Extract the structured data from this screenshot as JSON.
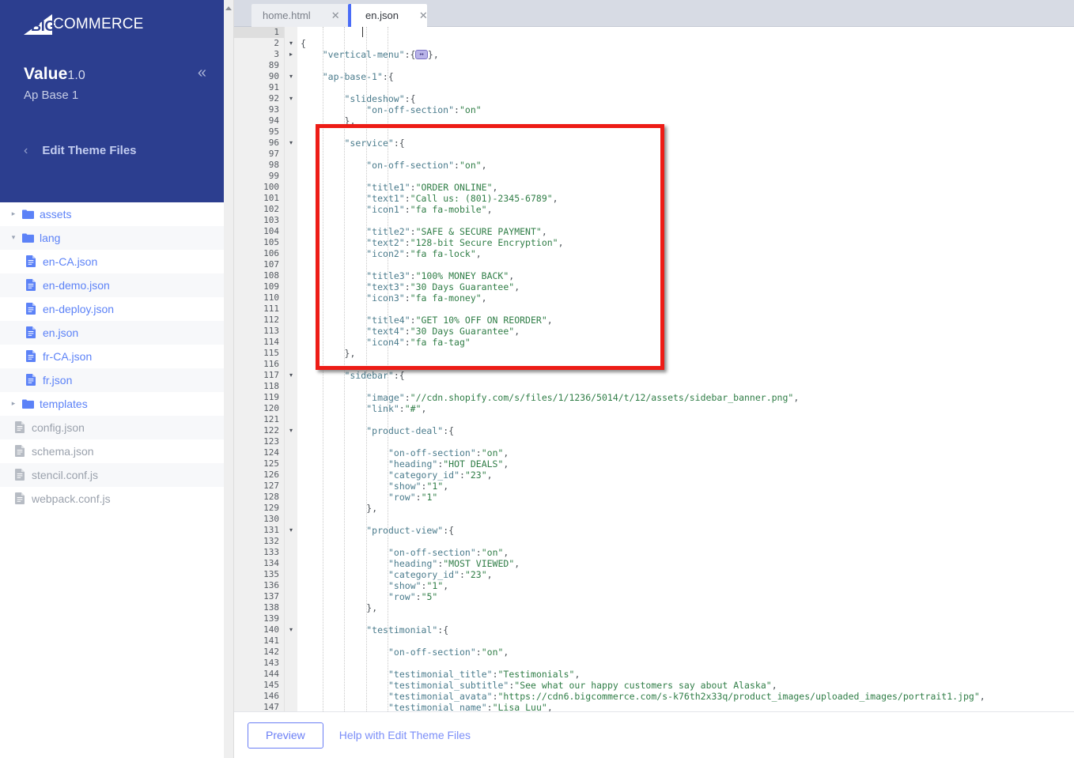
{
  "sidebar": {
    "brand": "COMMERCE",
    "brand_mark": "BIG",
    "theme_name": "Value",
    "theme_version": "1.0",
    "theme_variation": "Ap Base 1",
    "collapse_icon": "double-chevron-left-icon",
    "back_icon": "chevron-left-icon",
    "edit_theme_label": "Edit Theme Files",
    "tree": [
      {
        "label": "assets",
        "type": "folder",
        "state": "collapsed",
        "depth": 1,
        "muted": false
      },
      {
        "label": "lang",
        "type": "folder",
        "state": "expanded",
        "depth": 1,
        "muted": false
      },
      {
        "label": "en-CA.json",
        "type": "file",
        "state": "none",
        "depth": 2,
        "muted": false
      },
      {
        "label": "en-demo.json",
        "type": "file",
        "state": "none",
        "depth": 2,
        "muted": false
      },
      {
        "label": "en-deploy.json",
        "type": "file",
        "state": "none",
        "depth": 2,
        "muted": false
      },
      {
        "label": "en.json",
        "type": "file",
        "state": "none",
        "depth": 2,
        "muted": false
      },
      {
        "label": "fr-CA.json",
        "type": "file",
        "state": "none",
        "depth": 2,
        "muted": false
      },
      {
        "label": "fr.json",
        "type": "file",
        "state": "none",
        "depth": 2,
        "muted": false
      },
      {
        "label": "templates",
        "type": "folder",
        "state": "collapsed",
        "depth": 1,
        "muted": false
      },
      {
        "label": "config.json",
        "type": "file",
        "state": "none",
        "depth": 0,
        "muted": true
      },
      {
        "label": "schema.json",
        "type": "file",
        "state": "none",
        "depth": 0,
        "muted": true
      },
      {
        "label": "stencil.conf.js",
        "type": "file",
        "state": "none",
        "depth": 0,
        "muted": true
      },
      {
        "label": "webpack.conf.js",
        "type": "file",
        "state": "none",
        "depth": 0,
        "muted": true
      }
    ]
  },
  "tabs": [
    {
      "label": "home.html",
      "active": false,
      "close_icon": "close-icon"
    },
    {
      "label": "en.json",
      "active": true,
      "close_icon": "close-icon"
    }
  ],
  "editor": {
    "lines": [
      {
        "n": "1",
        "fold": "",
        "text": "",
        "current": true
      },
      {
        "n": "2",
        "fold": "▾",
        "text": "{"
      },
      {
        "n": "3",
        "fold": "▸",
        "text": "    \"vertical-menu\":{@FOLD@},"
      },
      {
        "n": "89",
        "fold": "",
        "text": ""
      },
      {
        "n": "90",
        "fold": "▾",
        "text": "    \"ap-base-1\":{"
      },
      {
        "n": "91",
        "fold": "",
        "text": ""
      },
      {
        "n": "92",
        "fold": "▾",
        "text": "        \"slideshow\":{"
      },
      {
        "n": "93",
        "fold": "",
        "text": "            \"on-off-section\":\"on\""
      },
      {
        "n": "94",
        "fold": "",
        "text": "        },"
      },
      {
        "n": "95",
        "fold": "",
        "text": ""
      },
      {
        "n": "96",
        "fold": "▾",
        "text": "        \"service\":{"
      },
      {
        "n": "97",
        "fold": "",
        "text": ""
      },
      {
        "n": "98",
        "fold": "",
        "text": "            \"on-off-section\":\"on\","
      },
      {
        "n": "99",
        "fold": "",
        "text": ""
      },
      {
        "n": "100",
        "fold": "",
        "text": "            \"title1\":\"ORDER ONLINE\","
      },
      {
        "n": "101",
        "fold": "",
        "text": "            \"text1\":\"Call us: (801)-2345-6789\","
      },
      {
        "n": "102",
        "fold": "",
        "text": "            \"icon1\":\"fa fa-mobile\","
      },
      {
        "n": "103",
        "fold": "",
        "text": ""
      },
      {
        "n": "104",
        "fold": "",
        "text": "            \"title2\":\"SAFE & SECURE PAYMENT\","
      },
      {
        "n": "105",
        "fold": "",
        "text": "            \"text2\":\"128-bit Secure Encryption\","
      },
      {
        "n": "106",
        "fold": "",
        "text": "            \"icon2\":\"fa fa-lock\","
      },
      {
        "n": "107",
        "fold": "",
        "text": ""
      },
      {
        "n": "108",
        "fold": "",
        "text": "            \"title3\":\"100% MONEY BACK\","
      },
      {
        "n": "109",
        "fold": "",
        "text": "            \"text3\":\"30 Days Guarantee\","
      },
      {
        "n": "110",
        "fold": "",
        "text": "            \"icon3\":\"fa fa-money\","
      },
      {
        "n": "111",
        "fold": "",
        "text": ""
      },
      {
        "n": "112",
        "fold": "",
        "text": "            \"title4\":\"GET 10% OFF ON REORDER\","
      },
      {
        "n": "113",
        "fold": "",
        "text": "            \"text4\":\"30 Days Guarantee\","
      },
      {
        "n": "114",
        "fold": "",
        "text": "            \"icon4\":\"fa fa-tag\""
      },
      {
        "n": "115",
        "fold": "",
        "text": "        },"
      },
      {
        "n": "116",
        "fold": "",
        "text": ""
      },
      {
        "n": "117",
        "fold": "▾",
        "text": "        \"sidebar\":{"
      },
      {
        "n": "118",
        "fold": "",
        "text": ""
      },
      {
        "n": "119",
        "fold": "",
        "text": "            \"image\":\"//cdn.shopify.com/s/files/1/1236/5014/t/12/assets/sidebar_banner.png\","
      },
      {
        "n": "120",
        "fold": "",
        "text": "            \"link\":\"#\","
      },
      {
        "n": "121",
        "fold": "",
        "text": ""
      },
      {
        "n": "122",
        "fold": "▾",
        "text": "            \"product-deal\":{"
      },
      {
        "n": "123",
        "fold": "",
        "text": ""
      },
      {
        "n": "124",
        "fold": "",
        "text": "                \"on-off-section\":\"on\","
      },
      {
        "n": "125",
        "fold": "",
        "text": "                \"heading\":\"HOT DEALS\","
      },
      {
        "n": "126",
        "fold": "",
        "text": "                \"category_id\":\"23\","
      },
      {
        "n": "127",
        "fold": "",
        "text": "                \"show\":\"1\","
      },
      {
        "n": "128",
        "fold": "",
        "text": "                \"row\":\"1\""
      },
      {
        "n": "129",
        "fold": "",
        "text": "            },"
      },
      {
        "n": "130",
        "fold": "",
        "text": ""
      },
      {
        "n": "131",
        "fold": "▾",
        "text": "            \"product-view\":{"
      },
      {
        "n": "132",
        "fold": "",
        "text": ""
      },
      {
        "n": "133",
        "fold": "",
        "text": "                \"on-off-section\":\"on\","
      },
      {
        "n": "134",
        "fold": "",
        "text": "                \"heading\":\"MOST VIEWED\","
      },
      {
        "n": "135",
        "fold": "",
        "text": "                \"category_id\":\"23\","
      },
      {
        "n": "136",
        "fold": "",
        "text": "                \"show\":\"1\","
      },
      {
        "n": "137",
        "fold": "",
        "text": "                \"row\":\"5\""
      },
      {
        "n": "138",
        "fold": "",
        "text": "            },"
      },
      {
        "n": "139",
        "fold": "",
        "text": ""
      },
      {
        "n": "140",
        "fold": "▾",
        "text": "            \"testimonial\":{"
      },
      {
        "n": "141",
        "fold": "",
        "text": ""
      },
      {
        "n": "142",
        "fold": "",
        "text": "                \"on-off-section\":\"on\","
      },
      {
        "n": "143",
        "fold": "",
        "text": ""
      },
      {
        "n": "144",
        "fold": "",
        "text": "                \"testimonial_title\":\"Testimonials\","
      },
      {
        "n": "145",
        "fold": "",
        "text": "                \"testimonial_subtitle\":\"See what our happy customers say about Alaska\","
      },
      {
        "n": "146",
        "fold": "",
        "text": "                \"testimonial_avata\":\"https://cdn6.bigcommerce.com/s-k76th2x33q/product_images/uploaded_images/portrait1.jpg\","
      },
      {
        "n": "147",
        "fold": "",
        "text": "                \"testimonial_name\":\"Lisa Luu\","
      }
    ]
  },
  "annotation": {
    "highlight_color": "#ed1c16",
    "shape": "rectangle"
  },
  "bottombar": {
    "preview_label": "Preview",
    "help_label": "Help with Edit Theme Files"
  },
  "colors": {
    "brand_navy": "#2c3e8f",
    "link_blue": "#5c82f7",
    "accent_blue": "#6a7ef5",
    "tabbar_bg": "#d7dbe4",
    "key_color": "#4a7b8c",
    "value_color": "#2f7d46"
  }
}
